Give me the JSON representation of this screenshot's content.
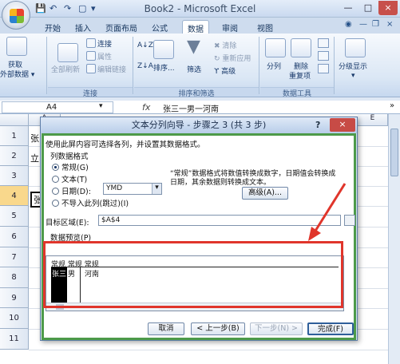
{
  "window": {
    "title": "Book2 - Microsoft Excel",
    "controls": {
      "minimize": "—",
      "maximize": "□",
      "close": "×"
    }
  },
  "qat": {
    "save": "💾",
    "undo": "↶",
    "redo": "↷",
    "print": "▢",
    "more": "▾"
  },
  "ribbon": {
    "tabs": [
      "开始",
      "插入",
      "页面布局",
      "公式",
      "数据",
      "审阅",
      "视图"
    ],
    "active_tab": "数据",
    "right_icons": {
      "help": "◉",
      "minimize": "—",
      "restore": "❐",
      "close": "×"
    },
    "groups": {
      "get_external": {
        "label_line1": "获取",
        "label_line2": "外部数据 ▾"
      },
      "connections": {
        "label": "连接",
        "refresh_all": "全部刷新",
        "connections": "连接",
        "properties": "属性",
        "edit_links": "编辑链接"
      },
      "sort_filter": {
        "label": "排序和筛选",
        "sort": "排序...",
        "filter": "筛选",
        "clear": "清除",
        "reapply": "重新应用",
        "advanced": "高级"
      },
      "data_tools": {
        "label": "数据工具",
        "split": "分列",
        "remove_dup_line1": "删除",
        "remove_dup_line2": "重复项"
      },
      "outline": {
        "label": "分级显示"
      }
    }
  },
  "formula_bar": {
    "name_box": "A4",
    "fx": "fx",
    "value": "张三一男一河南"
  },
  "sheet": {
    "columns": [
      "A",
      "E"
    ],
    "rows": [
      "1",
      "2",
      "3",
      "4",
      "5",
      "6",
      "7",
      "8",
      "9",
      "10",
      "11"
    ],
    "selected_row": "4",
    "cells": {
      "r1": "张",
      "r2": "立",
      "r4": "张"
    }
  },
  "dialog": {
    "title": "文本分列向导 - 步骤之 3 (共 3 步)",
    "help": "?",
    "close": "×",
    "intro": "使用此屏内容可选择各列，并设置其数据格式。",
    "format_group_label": "列数据格式",
    "options": [
      "常规(G)",
      "文本(T)",
      "日期(D):",
      "不导入此列(跳过)(I)"
    ],
    "selected_option": "常规(G)",
    "date_format": "YMD",
    "description_line1": "“常规”数据格式将数值转换成数字，日期值会转换成",
    "description_line2": "日期，其余数据则转换成文本。",
    "advanced_button": "高级(A)...",
    "target_label": "目标区域(E):",
    "target_value": "$A$4",
    "preview_label": "数据预览(P)",
    "preview": {
      "headers": [
        "常规",
        "常规",
        "常规"
      ],
      "row": [
        "张三",
        "男",
        "河南"
      ]
    },
    "buttons": {
      "cancel": "取消",
      "back": "< 上一步(B)",
      "next": "下一步(N) >",
      "finish": "完成(F)"
    }
  },
  "colors": {
    "annotation_red": "#e0352b",
    "dialog_green_border": "#4d9a49",
    "close_red": "#c74b46"
  }
}
